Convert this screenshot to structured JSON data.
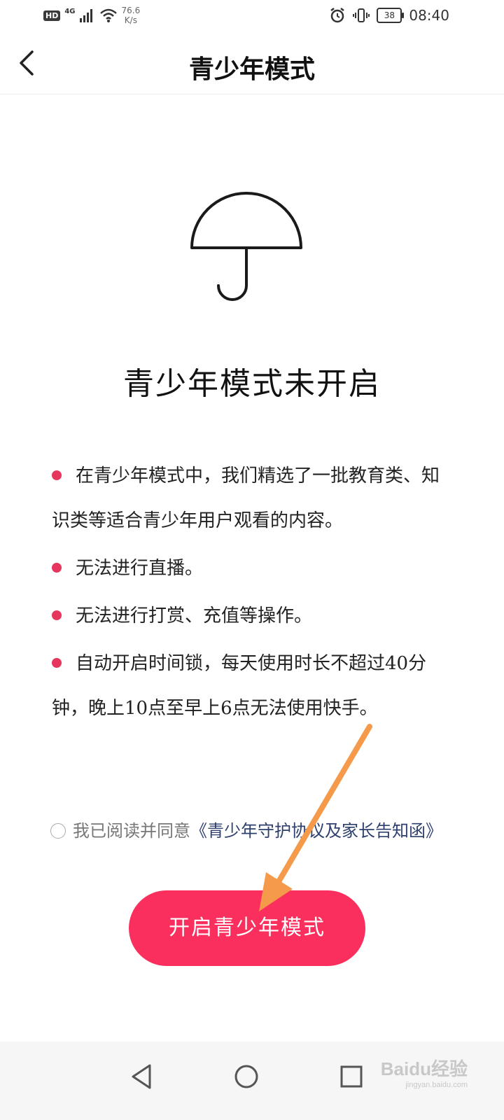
{
  "status_bar": {
    "hd": "HD",
    "network": "4G",
    "speed_value": "76.6",
    "speed_unit": "K/s",
    "battery": "38",
    "time": "08:40"
  },
  "nav": {
    "title": "青少年模式",
    "back_icon": "chevron-left-icon"
  },
  "illustration": {
    "icon": "umbrella-icon"
  },
  "status_title": "青少年模式未开启",
  "rules": [
    "在青少年模式中，我们精选了一批教育类、知识类等适合青少年用户观看的内容。",
    "无法进行直播。",
    "无法进行打赏、充值等操作。",
    "自动开启时间锁，每天使用时长不超过40分钟，晚上10点至早上6点无法使用快手。"
  ],
  "agreement": {
    "prefix": "我已阅读并同意",
    "link": "《青少年守护协议及家长告知函》",
    "checked": false
  },
  "enable_button": "开启青少年模式",
  "colors": {
    "accent": "#fa2f5d",
    "bullet": "#e6365d",
    "link": "#2d3f6e",
    "arrow": "#f59a4a"
  },
  "system_nav": {
    "back": "triangle-back-icon",
    "home": "circle-home-icon",
    "recent": "square-recent-icon"
  },
  "watermark": {
    "text": "Baidu经验",
    "sub": "jingyan.baidu.com"
  }
}
